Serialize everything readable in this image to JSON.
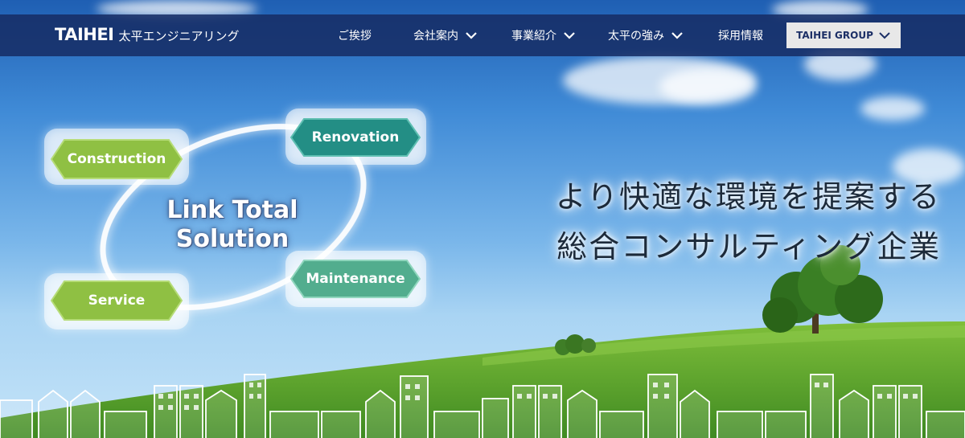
{
  "nav": {
    "logo_mark": "TAIHEI",
    "logo_sub": "太平エンジニアリング",
    "items": [
      {
        "label": "ご挨拶",
        "has_dropdown": false
      },
      {
        "label": "会社案内",
        "has_dropdown": true
      },
      {
        "label": "事業紹介",
        "has_dropdown": true
      },
      {
        "label": "太平の強み",
        "has_dropdown": true
      },
      {
        "label": "採用情報",
        "has_dropdown": false
      }
    ],
    "group_button": "TAIHEI GROUP"
  },
  "hero": {
    "diagram_title_line1": "Link Total",
    "diagram_title_line2": "Solution",
    "cycle": {
      "construction": "Construction",
      "renovation": "Renovation",
      "maintenance": "Maintenance",
      "service": "Service"
    },
    "tagline_line1": "より快適な環境を提案する",
    "tagline_line2": "総合コンサルティング企業"
  },
  "colors": {
    "nav_bg": "#162c64",
    "green_hex": "#8fc043",
    "teal_hex": "#2a9e8f",
    "maintenance_hex": "#56b092",
    "grass": "#5a9e2c"
  }
}
